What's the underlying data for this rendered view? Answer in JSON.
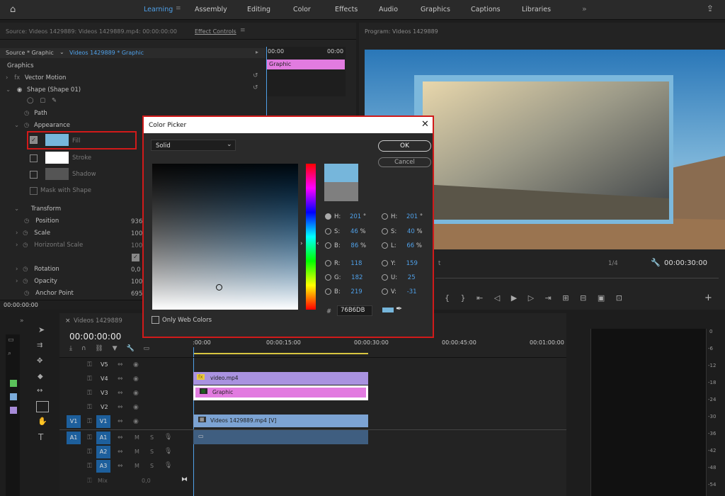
{
  "workspaces": [
    "Learning",
    "Assembly",
    "Editing",
    "Color",
    "Effects",
    "Audio",
    "Graphics",
    "Captions",
    "Libraries"
  ],
  "source_panel": {
    "title": "Source: Videos 1429889: Videos 1429889.mp4: 00:00:00:00",
    "effect_controls_tab": "Effect Controls"
  },
  "ec_tabs": {
    "source": "Source * Graphic",
    "sequence": "Videos 1429889 * Graphic"
  },
  "ec_ruler": {
    "start": "00:00",
    "end": "00:00",
    "clip": "Graphic"
  },
  "ec": {
    "graphics": "Graphics",
    "vector_motion": "Vector Motion",
    "shape": "Shape (Shape 01)",
    "path": "Path",
    "appearance": "Appearance",
    "fill": "Fill",
    "stroke": "Stroke",
    "shadow": "Shadow",
    "mask": "Mask with Shape",
    "transform": "Transform",
    "position": "Position",
    "position_val": "936,",
    "scale": "Scale",
    "scale_val": "100",
    "hscale": "Horizontal Scale",
    "hscale_val": "100",
    "rotation": "Rotation",
    "rotation_val": "0,0",
    "opacity": "Opacity",
    "opacity_val": "100",
    "anchor": "Anchor Point",
    "anchor_val": "695,",
    "timecode": "00:00:00:00"
  },
  "program": {
    "title": "Program: Videos 1429889",
    "zoom": "1/4",
    "timecode": "00:00:30:00",
    "fit_fragment": "t"
  },
  "timeline": {
    "seq_tab": "Videos 1429889",
    "timecode": "00:00:00:00",
    "ticks": [
      ":00:00",
      "00:00:15:00",
      "00:00:30:00",
      "00:00:45:00",
      "00:01:00:00"
    ],
    "tracks": [
      "V5",
      "V4",
      "V3",
      "V2",
      "V1",
      "A1",
      "A2",
      "A3"
    ],
    "src_v": "V1",
    "src_a": "A1",
    "mix": "Mix",
    "mix_val": "0,0",
    "clips": {
      "video": "video.mp4",
      "graphic": "Graphic",
      "v1": "Videos 1429889.mp4 [V]"
    }
  },
  "meters": [
    "0",
    "-6",
    "-12",
    "-18",
    "-24",
    "-30",
    "-36",
    "-42",
    "-48",
    "-54"
  ],
  "color_picker": {
    "title": "Color Picker",
    "mode": "Solid",
    "ok": "OK",
    "cancel": "Cancel",
    "web_colors": "Only Web Colors",
    "hex": "76B6DB",
    "hash": "#",
    "left": [
      [
        "H:",
        "201",
        "°"
      ],
      [
        "S:",
        "46",
        "%"
      ],
      [
        "B:",
        "86",
        "%"
      ],
      [
        "R:",
        "118",
        ""
      ],
      [
        "G:",
        "182",
        ""
      ],
      [
        "B:",
        "219",
        ""
      ]
    ],
    "right": [
      [
        "H:",
        "201",
        "°"
      ],
      [
        "S:",
        "40",
        "%"
      ],
      [
        "L:",
        "66",
        "%"
      ],
      [
        "Y:",
        "159",
        ""
      ],
      [
        "U:",
        "25",
        ""
      ],
      [
        "V:",
        "-31",
        ""
      ]
    ],
    "new_color": "#76b6db",
    "old_color": "#7f7f7f"
  }
}
